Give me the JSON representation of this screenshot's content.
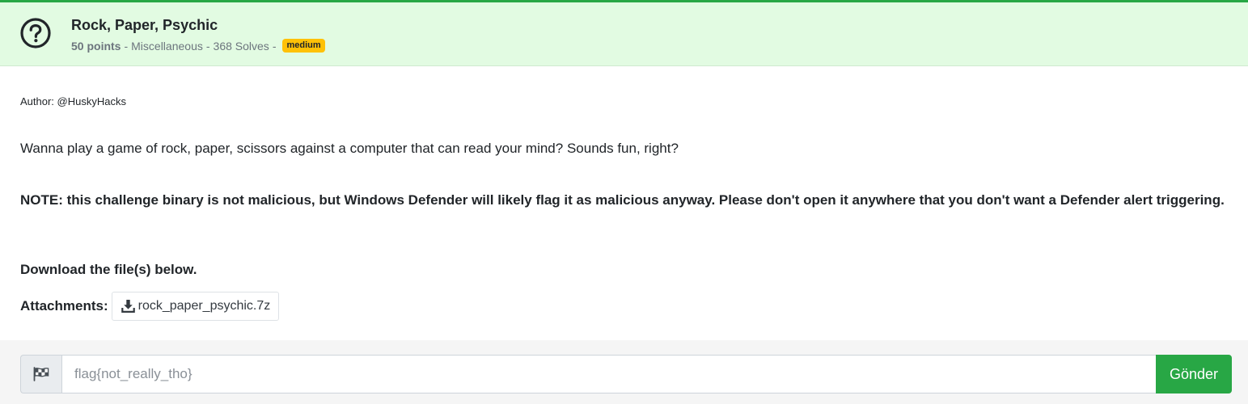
{
  "challenge": {
    "title": "Rock, Paper, Psychic",
    "points": "50 points",
    "category": "Miscellaneous",
    "solves": "368 Solves",
    "difficulty": "medium",
    "separator": "-"
  },
  "icons": {
    "header": "question-circle-icon",
    "attachment": "download-icon",
    "flag": "flag-checkered-icon"
  },
  "body": {
    "author": "Author: @HuskyHacks",
    "description": "Wanna play a game of rock, paper, scissors against a computer that can read your mind? Sounds fun, right?",
    "note": "NOTE: this challenge binary is not malicious, but Windows Defender will likely flag it as malicious anyway. Please don't open it anywhere that you don't want a Defender alert triggering.",
    "download_text": "Download the file(s) below.",
    "attachments_label": "Attachments:",
    "attachments": [
      {
        "filename": "rock_paper_psychic.7z"
      }
    ]
  },
  "submission": {
    "placeholder": "flag{not_really_tho}",
    "value": "",
    "submit_label": "Gönder"
  },
  "colors": {
    "header_bg": "#e2fbe2",
    "accent_green": "#28a745",
    "badge_yellow": "#ffc107"
  }
}
